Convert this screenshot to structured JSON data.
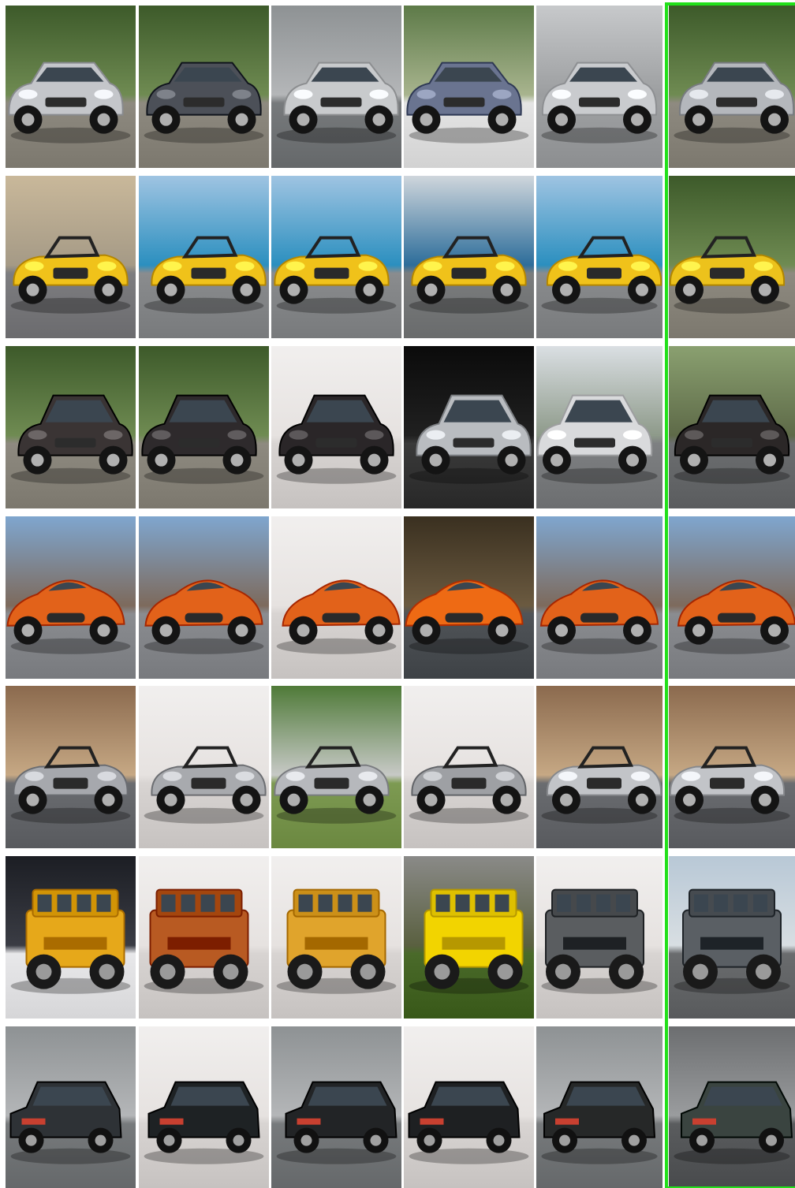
{
  "grid": {
    "rows": 7,
    "columns": 6,
    "highlighted_column": 6,
    "highlight_color": "#22e01a"
  },
  "rows": [
    {
      "subject": "sedan",
      "car_color": "#b8bcc2",
      "backgrounds": [
        "forest",
        "forest",
        "gray",
        "trees",
        "gray-road",
        "forest"
      ],
      "cells": [
        {
          "car_color": "#c4c6ca"
        },
        {
          "car_color": "#4c5058"
        },
        {
          "car_color": "#c8cacc"
        },
        {
          "car_color": "#6a7490"
        },
        {
          "car_color": "#c9cbce"
        },
        {
          "car_color": "#b4b7bc"
        }
      ]
    },
    {
      "subject": "convertible",
      "backgrounds": [
        "sand",
        "sea",
        "sea",
        "harbor",
        "sea",
        "forest"
      ],
      "cells": [
        {
          "car_color": "#f0c21a"
        },
        {
          "car_color": "#f0c21a"
        },
        {
          "car_color": "#f0c21a"
        },
        {
          "car_color": "#f0c21a"
        },
        {
          "car_color": "#f0c21a"
        },
        {
          "car_color": "#ecc21c"
        }
      ]
    },
    {
      "subject": "crossover",
      "backgrounds": [
        "forest",
        "forest",
        "white",
        "black",
        "overcast",
        "hills"
      ],
      "cells": [
        {
          "car_color": "#3a3434"
        },
        {
          "car_color": "#2e2a2c"
        },
        {
          "car_color": "#2a2628"
        },
        {
          "car_color": "#b9bcc0"
        },
        {
          "car_color": "#d9dadc"
        },
        {
          "car_color": "#2b2727"
        }
      ]
    },
    {
      "subject": "coupe",
      "backgrounds": [
        "mountain",
        "mountain",
        "white",
        "show",
        "mountain",
        "mountain"
      ],
      "cells": [
        {
          "car_color": "#e2621a"
        },
        {
          "car_color": "#e2621a"
        },
        {
          "car_color": "#e2621a"
        },
        {
          "car_color": "#ee6a14"
        },
        {
          "car_color": "#e2621a"
        },
        {
          "car_color": "#e2621a"
        }
      ]
    },
    {
      "subject": "roadster",
      "backgrounds": [
        "rock",
        "white",
        "field",
        "white",
        "rock",
        "rock"
      ],
      "cells": [
        {
          "car_color": "#a6a8ad"
        },
        {
          "car_color": "#a8aaae"
        },
        {
          "car_color": "#b6b8bc"
        },
        {
          "car_color": "#9ea0a4"
        },
        {
          "car_color": "#c2c4c8"
        },
        {
          "car_color": "#c2c4c8"
        }
      ]
    },
    {
      "subject": "suv",
      "backgrounds": [
        "dark",
        "white",
        "white",
        "street",
        "white",
        "sky"
      ],
      "cells": [
        {
          "car_color": "#e6a81a"
        },
        {
          "car_color": "#b85a22"
        },
        {
          "car_color": "#e0a42c"
        },
        {
          "car_color": "#f2d400"
        },
        {
          "car_color": "#5a5d60"
        },
        {
          "car_color": "#5a5f64"
        }
      ]
    },
    {
      "subject": "wagon",
      "backgrounds": [
        "gray",
        "white",
        "gray",
        "white",
        "gray",
        "wet"
      ],
      "cells": [
        {
          "car_color": "#2e3236"
        },
        {
          "car_color": "#1e2224"
        },
        {
          "car_color": "#222426"
        },
        {
          "car_color": "#1e2022"
        },
        {
          "car_color": "#262828"
        },
        {
          "car_color": "#3a4440"
        }
      ]
    }
  ]
}
